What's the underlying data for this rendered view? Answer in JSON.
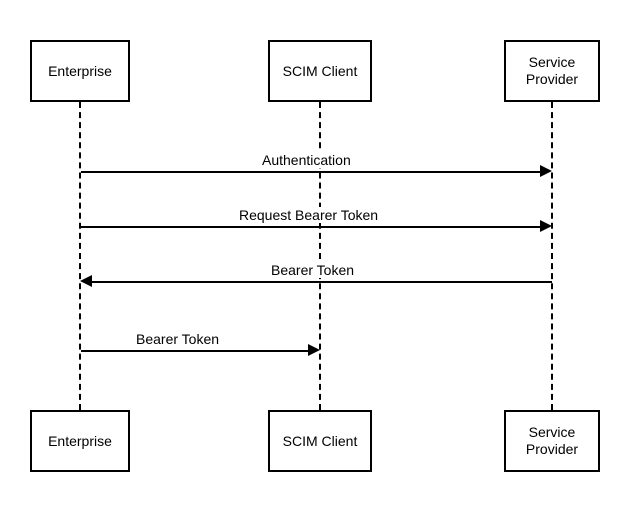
{
  "participants": {
    "enterprise": "Enterprise",
    "scim_client": "SCIM Client",
    "service_provider": "Service\nProvider"
  },
  "messages": {
    "m1": "Authentication",
    "m2": "Request Bearer Token",
    "m3": "Bearer Token",
    "m4": "Bearer Token"
  }
}
